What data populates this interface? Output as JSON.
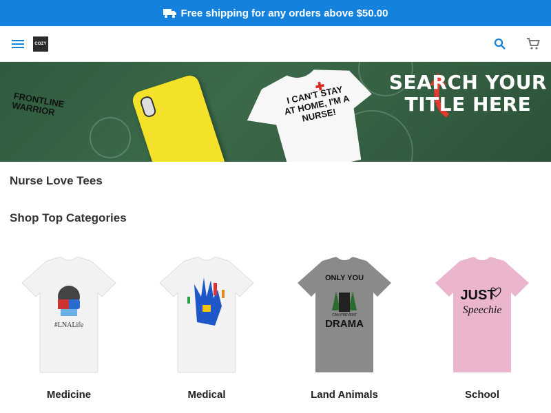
{
  "promo": {
    "text": "Free shipping for any orders above $50.00",
    "icon": "truck-icon"
  },
  "header": {
    "logo_text": "COZY",
    "icons": [
      "menu-icon",
      "search-icon",
      "cart-icon"
    ]
  },
  "hero": {
    "cta_line1": "SEARCH YOUR",
    "cta_line2": "TITLE HERE",
    "phone_text": "FRONTLINE WARRIOR",
    "shirt_text": "I CAN'T STAY AT HOME, I'M A NURSE!"
  },
  "store_title": "Nurse Love Tees",
  "categories_title": "Shop Top Categories",
  "categories": [
    {
      "label": "Medicine",
      "shirt_color": "#f2f2f2"
    },
    {
      "label": "Medical",
      "shirt_color": "#f2f2f2"
    },
    {
      "label": "Land Animals",
      "shirt_color": "#8a8a8a"
    },
    {
      "label": "School",
      "shirt_color": "#eab5cd"
    }
  ],
  "colors": {
    "accent": "#1481dc",
    "hero_bg": "#2f5a3e"
  }
}
